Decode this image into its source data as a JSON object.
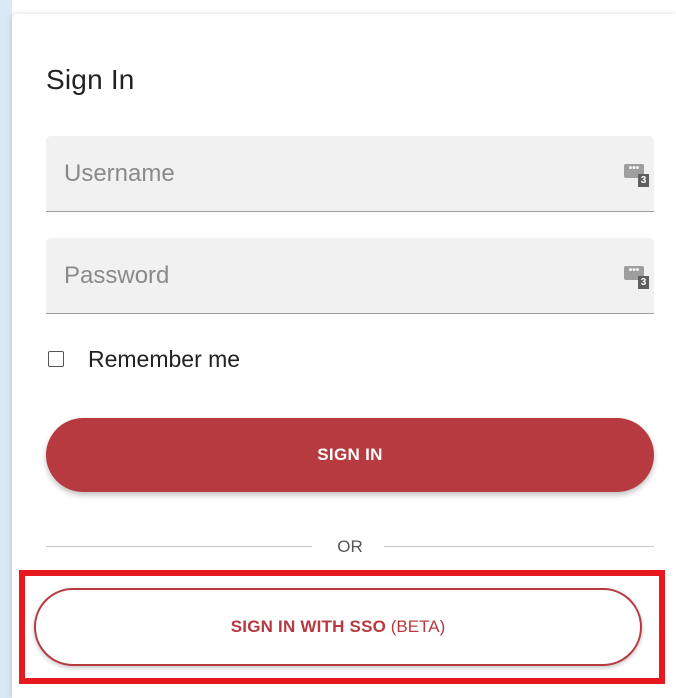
{
  "form": {
    "title": "Sign In",
    "username": {
      "value": "",
      "placeholder": "Username",
      "manager_icon": "password-manager-icon",
      "manager_count": "3"
    },
    "password": {
      "value": "",
      "placeholder": "Password",
      "manager_icon": "password-manager-icon",
      "manager_count": "3"
    },
    "remember_me": {
      "label": "Remember me",
      "checked": false
    },
    "sign_in_label": "SIGN IN",
    "divider_text": "OR",
    "sso_label": "SIGN IN WITH SSO",
    "sso_suffix": "(BETA)"
  },
  "colors": {
    "primary": "#b63a40",
    "highlight": "#e8181f",
    "field_bg": "#f1f1f1",
    "rail": "#dbe9f6"
  }
}
